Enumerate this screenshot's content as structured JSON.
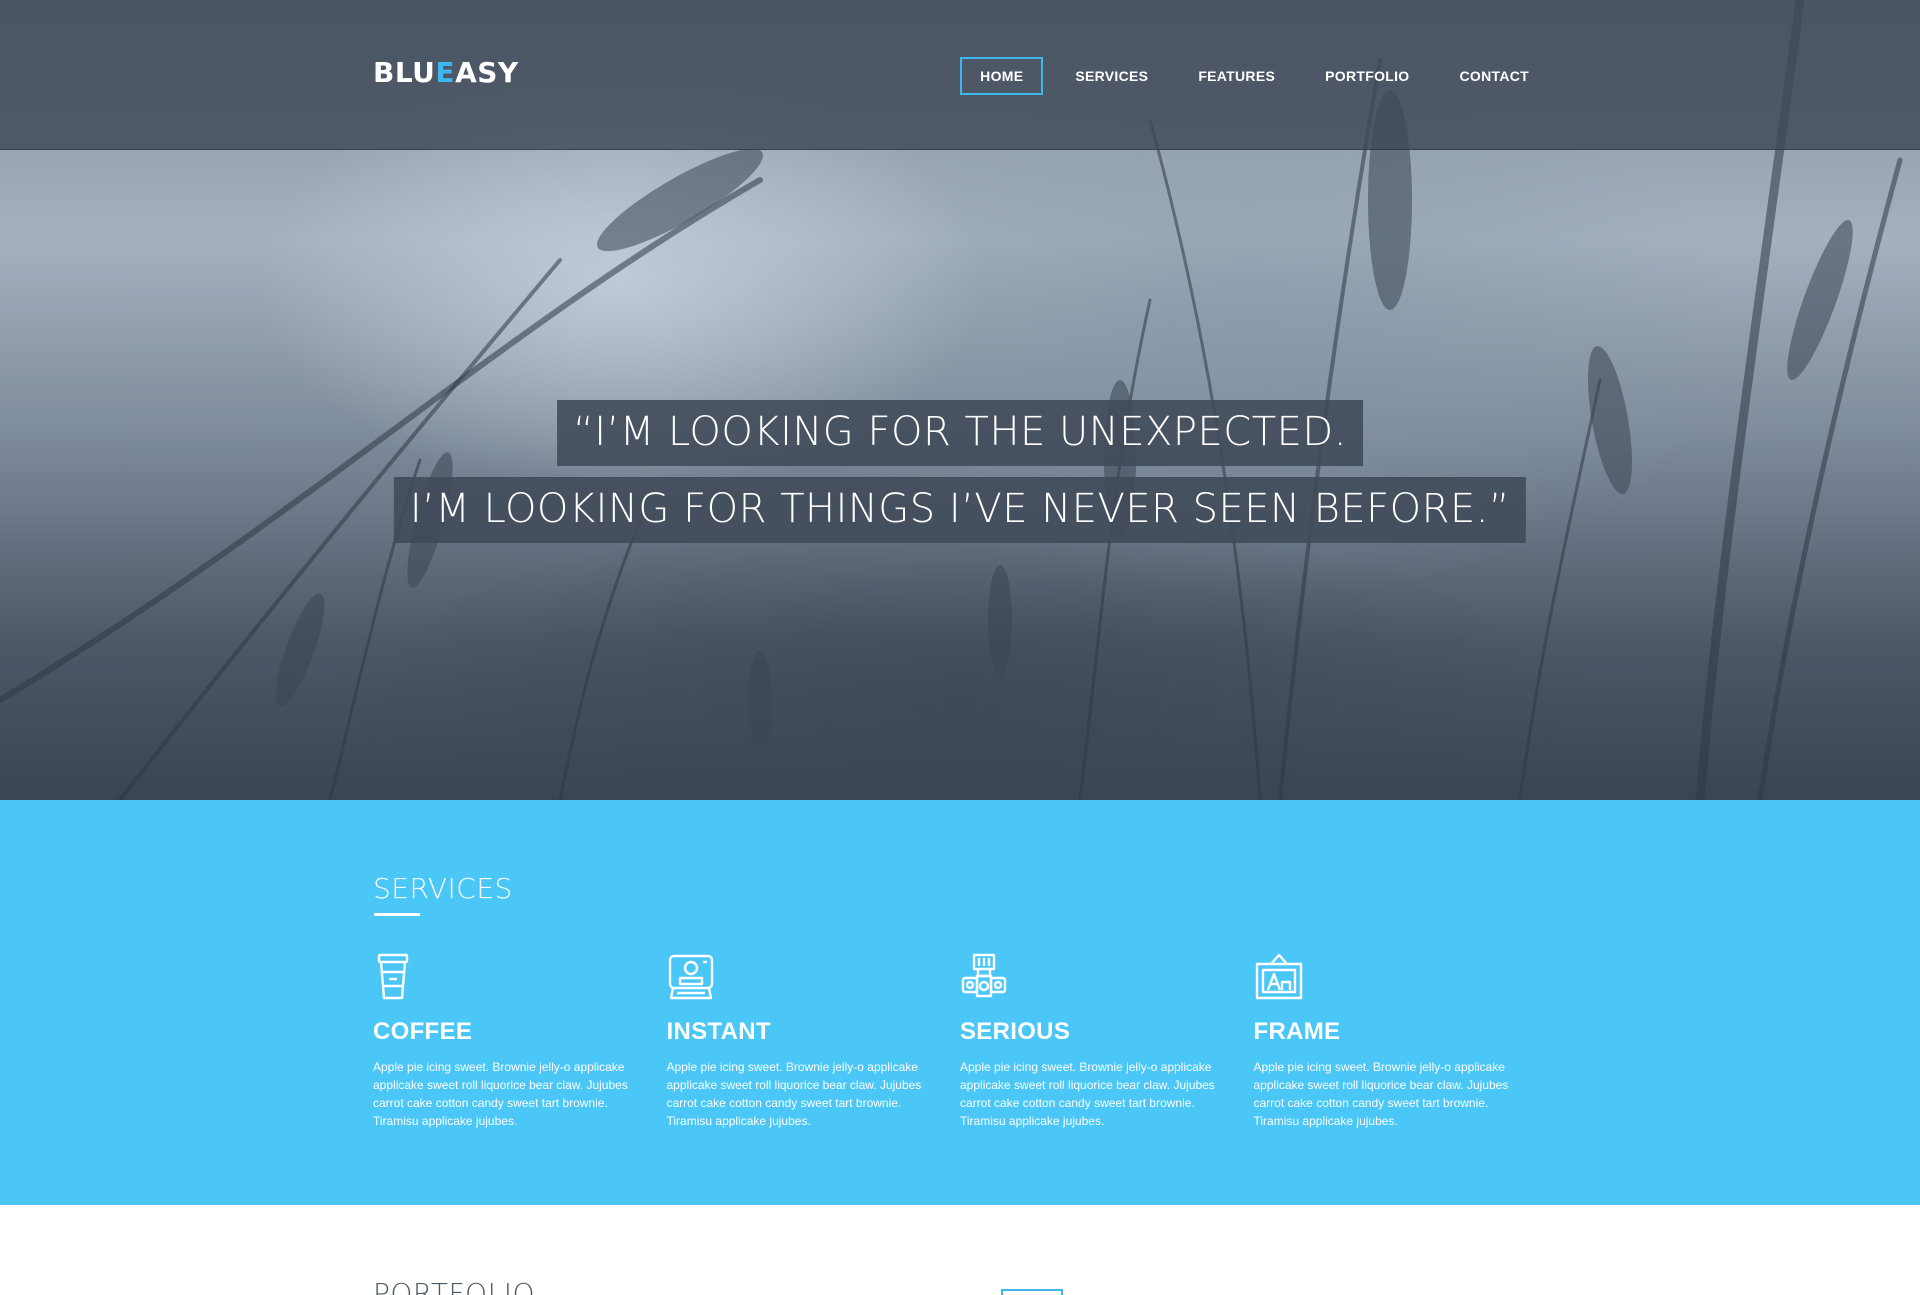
{
  "brand": {
    "logo_part1": "BLU",
    "logo_accent": "E",
    "logo_part2": "ASY"
  },
  "nav": {
    "items": [
      {
        "label": "HOME",
        "active": true
      },
      {
        "label": "SERVICES",
        "active": false
      },
      {
        "label": "FEATURES",
        "active": false
      },
      {
        "label": "PORTFOLIO",
        "active": false
      },
      {
        "label": "CONTACT",
        "active": false
      }
    ]
  },
  "hero": {
    "quote_line1": "“I’M LOOKING FOR THE UNEXPECTED.",
    "quote_line2": "I’M LOOKING FOR THINGS I’VE NEVER SEEN BEFORE.”"
  },
  "services": {
    "title": "SERVICES",
    "items": [
      {
        "icon": "coffee-cup-icon",
        "title": "COFFEE",
        "text": "Apple pie icing sweet. Brownie jelly-o applicake applicake sweet roll liquorice bear claw. Jujubes carrot cake cotton candy sweet tart brownie. Tiramisu applicake jujubes."
      },
      {
        "icon": "instant-camera-icon",
        "title": "INSTANT",
        "text": "Apple pie icing sweet. Brownie jelly-o applicake applicake sweet roll liquorice bear claw. Jujubes carrot cake cotton candy sweet tart brownie. Tiramisu applicake jujubes."
      },
      {
        "icon": "radio-icon",
        "title": "SERIOUS",
        "text": "Apple pie icing sweet. Brownie jelly-o applicake applicake sweet roll liquorice bear claw. Jujubes carrot cake cotton candy sweet tart brownie. Tiramisu applicake jujubes."
      },
      {
        "icon": "frame-icon",
        "title": "FRAME",
        "text": "Apple pie icing sweet. Brownie jelly-o applicake applicake sweet roll liquorice bear claw. Jujubes carrot cake cotton candy sweet tart brownie. Tiramisu applicake jujubes."
      }
    ]
  },
  "portfolio": {
    "title": "PORTFOLIO"
  },
  "colors": {
    "accent": "#3fb7ee",
    "services_bg": "#4ac6f7",
    "nav_bg": "#3e4856",
    "quote_bg": "#404a58",
    "white": "#ffffff"
  }
}
